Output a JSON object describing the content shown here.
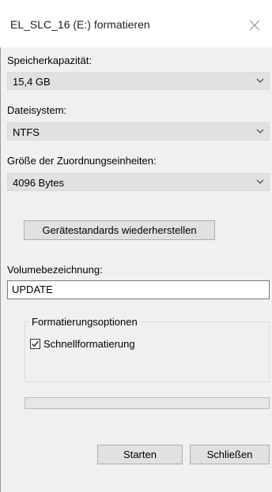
{
  "window": {
    "title": "EL_SLC_16 (E:) formatieren",
    "close_icon": "close-icon"
  },
  "capacity": {
    "label": "Speicherkapazität:",
    "value": "15,4 GB"
  },
  "filesystem": {
    "label": "Dateisystem:",
    "value": "NTFS"
  },
  "allocation": {
    "label": "Größe der Zuordnungseinheiten:",
    "value": "4096 Bytes"
  },
  "restore_defaults_label": "Gerätestandards wiederherstellen",
  "volume": {
    "label": "Volumebezeichnung:",
    "value": "UPDATE"
  },
  "format_options": {
    "title": "Formatierungsoptionen",
    "quick_format_label": "Schnellformatierung",
    "quick_format_checked": true
  },
  "progress": {
    "fraction": 0
  },
  "buttons": {
    "start_label": "Starten",
    "close_label": "Schließen"
  }
}
